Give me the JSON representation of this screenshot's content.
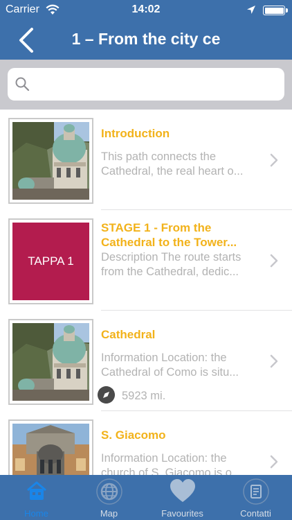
{
  "status": {
    "carrier": "Carrier",
    "time": "14:02"
  },
  "nav": {
    "title": "1 – From the city ce"
  },
  "search": {
    "placeholder": "",
    "value": ""
  },
  "items": [
    {
      "title": "Introduction",
      "description_lines": [
        "This path connects the",
        "Cathedral, the real heart o..."
      ],
      "thumb": "cathedral-photo"
    },
    {
      "title_lines": [
        "STAGE 1 - From the",
        "Cathedral to the Tower..."
      ],
      "description_lines": [
        "Description The route starts",
        "from the Cathedral, dedic..."
      ],
      "thumb_text": "TAPPA 1"
    },
    {
      "title": "Cathedral",
      "description_lines": [
        "Information Location: the",
        "Cathedral of Como is situ..."
      ],
      "distance": "5923 mi.",
      "thumb": "cathedral-photo"
    },
    {
      "title": "S. Giacomo",
      "description_lines": [
        "Information Location: the",
        "church of S. Giacomo is o..."
      ],
      "thumb": "church-photo"
    }
  ],
  "tabs": [
    {
      "label": "Home",
      "icon": "home-icon",
      "active": true
    },
    {
      "label": "Map",
      "icon": "globe-icon",
      "active": false
    },
    {
      "label": "Favourites",
      "icon": "heart-icon",
      "active": false
    },
    {
      "label": "Contatti",
      "icon": "contact-card-icon",
      "active": false
    }
  ],
  "colors": {
    "bar": "#3d70ab",
    "title": "#f2b21a",
    "desc": "#b3b3b3",
    "tappa": "#b31c4e",
    "active_tab": "#1a85e8"
  }
}
